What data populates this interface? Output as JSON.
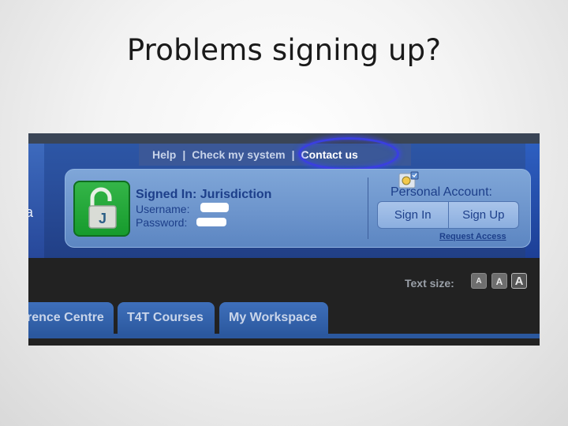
{
  "slide": {
    "title": "Problems signing up?"
  },
  "nav": {
    "help": "Help",
    "separator": "|",
    "check_system": "Check my system",
    "contact": "Contact us"
  },
  "left_partial_text": "a",
  "signin": {
    "title": "Signed In: Jurisdiction",
    "username_label": "Username:",
    "password_label": "Password:",
    "lock_letter": "J"
  },
  "account": {
    "label": "Personal Account:",
    "sign_in": "Sign In",
    "sign_up": "Sign Up",
    "request_access": "Request Access"
  },
  "text_size": {
    "label": "Text size:",
    "small": "A",
    "medium": "A",
    "large": "A"
  },
  "tabs": [
    {
      "label": "rence Centre"
    },
    {
      "label": "T4T Courses"
    },
    {
      "label": "My Workspace"
    }
  ],
  "colors": {
    "highlight_ring": "#3a3fe0",
    "lock_green": "#169b2d",
    "link_blue": "#1d3f8a"
  }
}
